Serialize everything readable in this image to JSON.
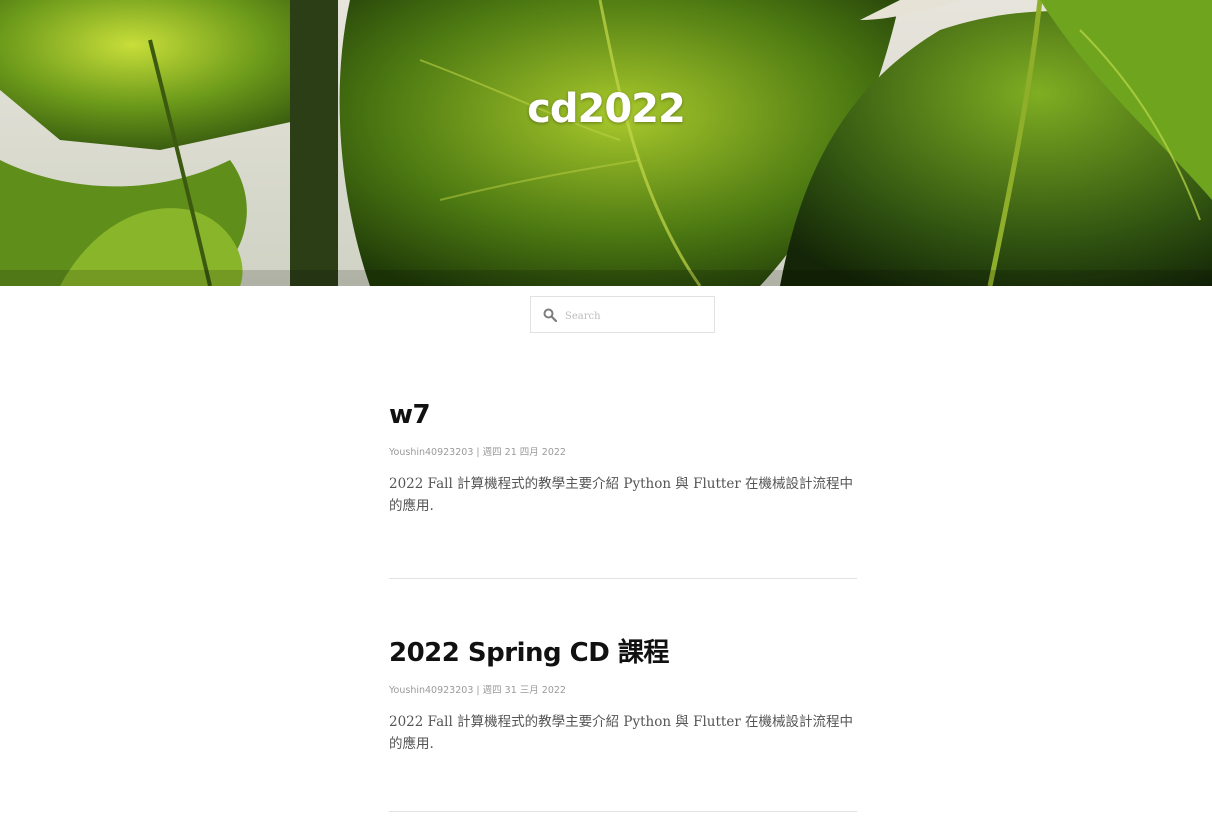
{
  "site": {
    "title": "cd2022"
  },
  "search": {
    "placeholder": "Search",
    "icon": "search-icon"
  },
  "colors": {
    "title_text": "#111111",
    "meta_text": "#9a9a9a",
    "summary_text": "#555555",
    "divider": "#e3e3e3"
  },
  "posts": [
    {
      "title": "w7",
      "author": "Youshin40923203",
      "separator": "|",
      "date": "週四 21 四月 2022",
      "summary": "2022 Fall 計算機程式的教學主要介紹 Python 與 Flutter 在機械設計流程中的應用."
    },
    {
      "title": "2022 Spring CD 課程",
      "author": "Youshin40923203",
      "separator": "|",
      "date": "週四 31 三月 2022",
      "summary": "2022 Fall 計算機程式的教學主要介紹 Python 與 Flutter 在機械設計流程中的應用."
    }
  ]
}
